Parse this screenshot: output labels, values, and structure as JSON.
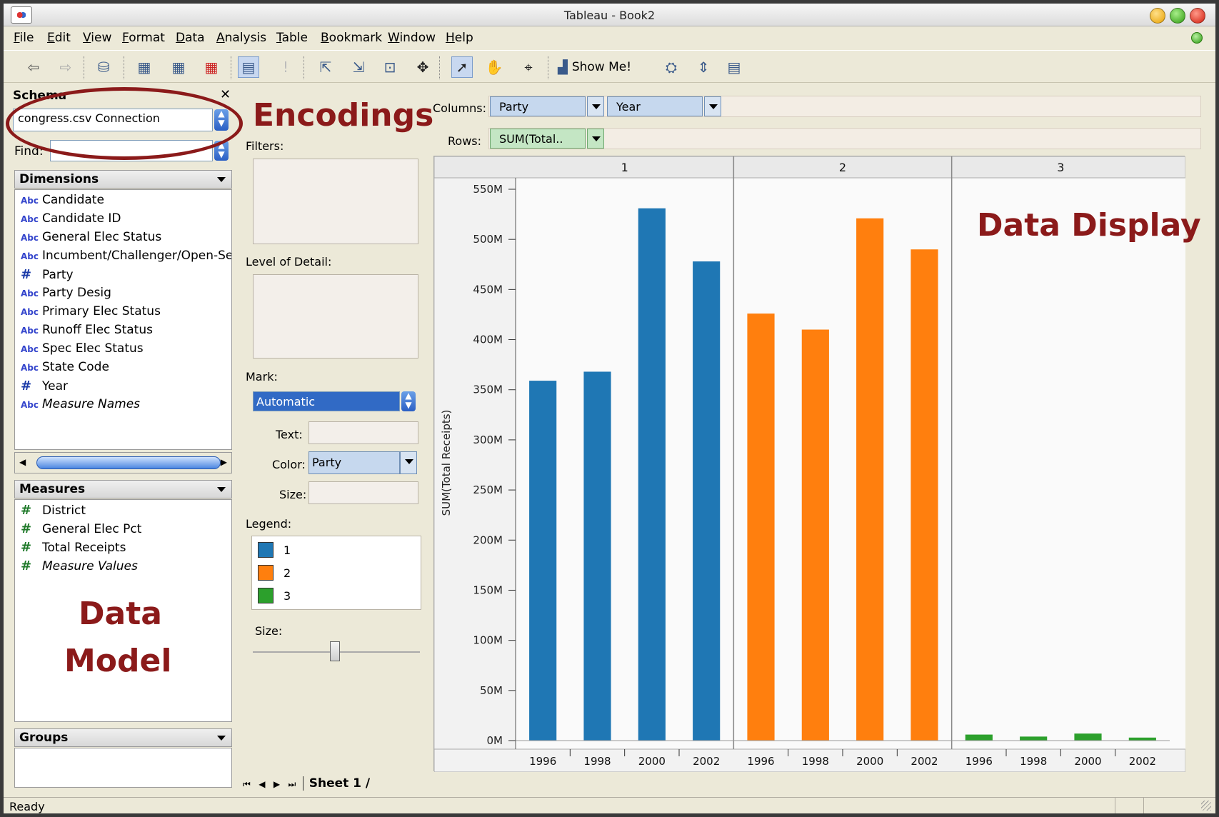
{
  "window": {
    "title": "Tableau - Book2"
  },
  "menu": [
    "File",
    "Edit",
    "View",
    "Format",
    "Data",
    "Analysis",
    "Table",
    "Bookmark",
    "Window",
    "Help"
  ],
  "toolbar": {
    "show_me_label": "Show Me!"
  },
  "schema": {
    "title": "Schema",
    "close_glyph": "✕",
    "connection": "congress.csv Connection",
    "find_label": "Find:",
    "find_value": ""
  },
  "dimensions": {
    "title": "Dimensions",
    "items": [
      {
        "type": "Abc",
        "label": "Candidate"
      },
      {
        "type": "Abc",
        "label": "Candidate ID"
      },
      {
        "type": "Abc",
        "label": "General Elec Status"
      },
      {
        "type": "Abc",
        "label": "Incumbent/Challenger/Open-Seat"
      },
      {
        "type": "#",
        "label": "Party"
      },
      {
        "type": "Abc",
        "label": "Party Desig"
      },
      {
        "type": "Abc",
        "label": "Primary Elec Status"
      },
      {
        "type": "Abc",
        "label": "Runoff Elec Status"
      },
      {
        "type": "Abc",
        "label": "Spec Elec Status"
      },
      {
        "type": "Abc",
        "label": "State Code"
      },
      {
        "type": "#",
        "label": "Year"
      },
      {
        "type": "Abc",
        "label": "Measure Names"
      }
    ]
  },
  "measures": {
    "title": "Measures",
    "items": [
      {
        "type": "#",
        "label": "District"
      },
      {
        "type": "#",
        "label": "General Elec Pct"
      },
      {
        "type": "#",
        "label": "Total Receipts"
      },
      {
        "type": "#",
        "label": "Measure Values"
      }
    ]
  },
  "groups": {
    "title": "Groups"
  },
  "annotations": {
    "encodings": "Encodings",
    "data_model_1": "Data",
    "data_model_2": "Model",
    "data_display": "Data Display"
  },
  "cards": {
    "filters": "Filters:",
    "level_of_detail": "Level of Detail:",
    "mark": "Mark:",
    "mark_value": "Automatic",
    "text": "Text:",
    "color": "Color:",
    "color_value": "Party",
    "size": "Size:",
    "legend": "Legend:",
    "legend_items": [
      "1",
      "2",
      "3"
    ],
    "size2": "Size:"
  },
  "shelves": {
    "columns_label": "Columns:",
    "rows_label": "Rows:",
    "columns": [
      "Party",
      "Year"
    ],
    "rows": [
      "SUM(Total.."
    ]
  },
  "colors": {
    "party1": "#1f77b4",
    "party2": "#ff7f0e",
    "party3": "#2ca02c",
    "annotation": "#8b1a1a"
  },
  "chart_data": {
    "type": "bar",
    "panels": [
      "1",
      "2",
      "3"
    ],
    "categories": [
      "1996",
      "1998",
      "2000",
      "2002"
    ],
    "series": [
      {
        "name": "1",
        "values": [
          359,
          368,
          531,
          478
        ]
      },
      {
        "name": "2",
        "values": [
          426,
          410,
          521,
          490
        ]
      },
      {
        "name": "3",
        "values": [
          6,
          4,
          7,
          3
        ]
      }
    ],
    "ylabel": "SUM(Total Receipts)",
    "yticks": [
      "0M",
      "50M",
      "100M",
      "150M",
      "200M",
      "250M",
      "300M",
      "350M",
      "400M",
      "450M",
      "500M",
      "550M"
    ],
    "ylim": [
      0,
      550
    ],
    "unit": "M"
  },
  "sheet": {
    "tab": "Sheet 1"
  },
  "status": {
    "text": "Ready"
  }
}
